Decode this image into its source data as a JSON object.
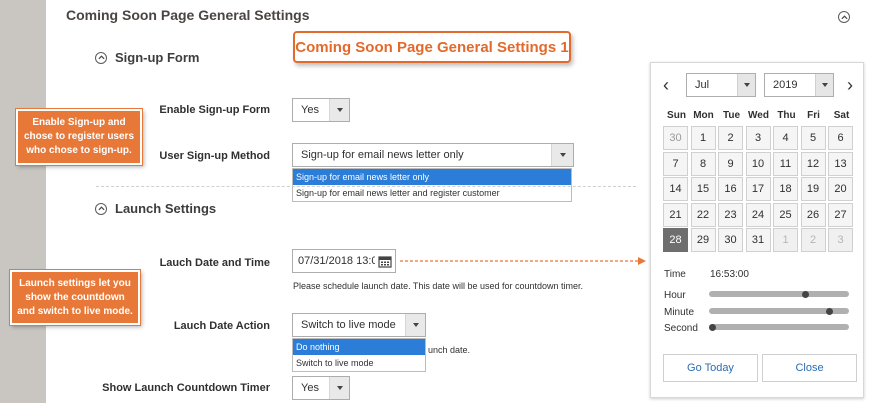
{
  "page": {
    "title": "Coming Soon Page General Settings"
  },
  "callouts": {
    "banner": "Coming Soon Page General Settings 1",
    "signup_note": [
      "Enable Sign-up and",
      "chose to register users",
      "who chose to sign-up."
    ],
    "launch_note": [
      "Launch settings let you",
      "show the countdown",
      "and switch to live mode."
    ]
  },
  "signup": {
    "heading": "Sign-up Form",
    "enable_label": "Enable Sign-up Form",
    "enable_value": "Yes",
    "method_label": "User Sign-up Method",
    "method_value": "Sign-up for email news letter only",
    "method_options": [
      "Sign-up for email news letter only",
      "Sign-up for email news letter and register customer"
    ]
  },
  "launch": {
    "heading": "Launch Settings",
    "date_label": "Lauch Date and Time",
    "date_value": "07/31/2018 13:0",
    "date_note": "Please schedule launch date. This date will be used for countdown timer.",
    "action_label": "Lauch Date Action",
    "action_value": "Switch to live mode",
    "action_options": [
      "Do nothing",
      "Switch to live mode"
    ],
    "action_note_tail": "unch date.",
    "countdown_label": "Show Launch Countdown Timer",
    "countdown_value": "Yes"
  },
  "calendar": {
    "prev": "‹",
    "next": "›",
    "month": "Jul",
    "year": "2019",
    "weekdays": [
      "Sun",
      "Mon",
      "Tue",
      "Wed",
      "Thu",
      "Fri",
      "Sat"
    ],
    "weeks": [
      [
        "30",
        "1",
        "2",
        "3",
        "4",
        "5",
        "6"
      ],
      [
        "7",
        "8",
        "9",
        "10",
        "11",
        "12",
        "13"
      ],
      [
        "14",
        "15",
        "16",
        "17",
        "18",
        "19",
        "20"
      ],
      [
        "21",
        "22",
        "23",
        "24",
        "25",
        "26",
        "27"
      ],
      [
        "28",
        "29",
        "30",
        "31",
        "1",
        "2",
        "3"
      ]
    ],
    "time_label": "Time",
    "time_value": "16:53:00",
    "hour_label": "Hour",
    "minute_label": "Minute",
    "second_label": "Second",
    "hour_level": 0.7,
    "minute_level": 0.88,
    "second_level": 0.0,
    "go_today": "Go Today",
    "close": "Close"
  },
  "colors": {
    "accent_orange": "#e87838",
    "selected_blue": "#2b7dd8",
    "link_blue": "#2a6db5"
  }
}
